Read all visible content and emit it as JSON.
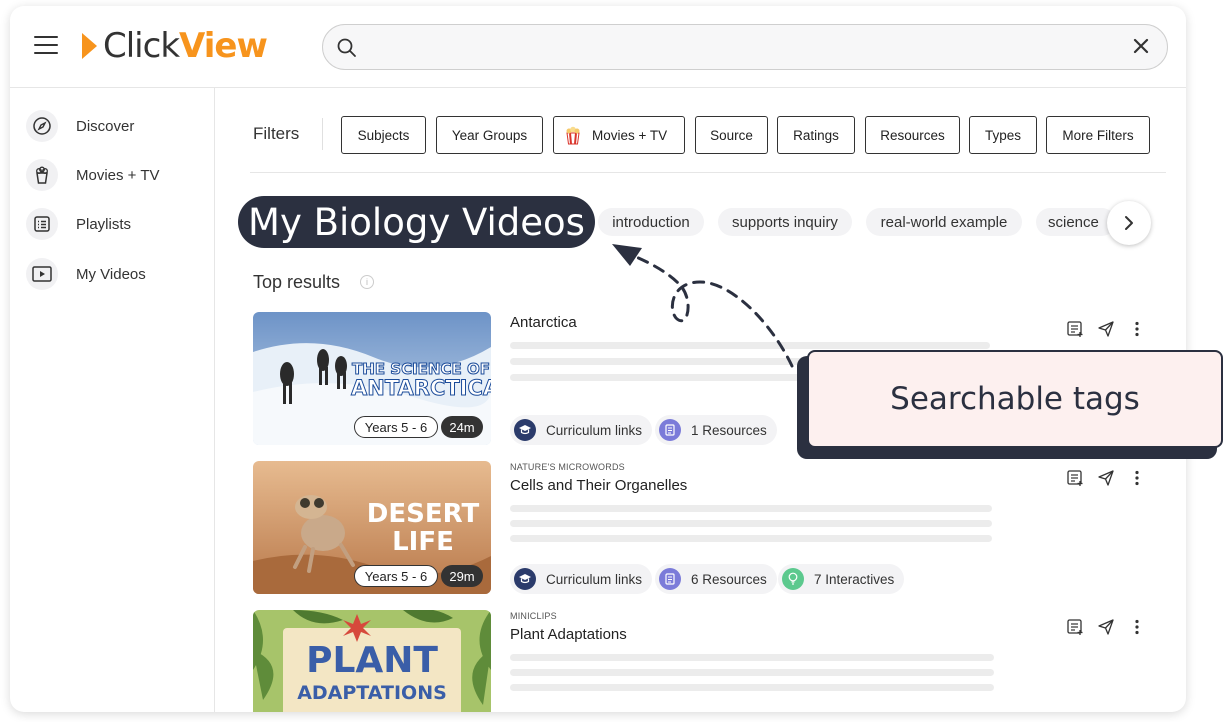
{
  "app": {
    "logo_part1": "Click",
    "logo_part2": "View"
  },
  "search": {
    "value": "",
    "placeholder": ""
  },
  "sidebar": {
    "items": [
      {
        "label": "Discover",
        "icon": "compass-icon"
      },
      {
        "label": "Movies + TV",
        "icon": "popcorn-icon"
      },
      {
        "label": "Playlists",
        "icon": "list-icon"
      },
      {
        "label": "My Videos",
        "icon": "play-icon"
      }
    ]
  },
  "filters": {
    "label": "Filters",
    "buttons": [
      "Subjects",
      "Year Groups",
      "Movies + TV",
      "Source",
      "Ratings",
      "Resources",
      "Types",
      "More Filters"
    ]
  },
  "tags": {
    "highlight": "My Biology Videos",
    "items": [
      "introduction",
      "supports inquiry",
      "real-world example",
      "science"
    ]
  },
  "top_results": {
    "label": "Top results"
  },
  "results": [
    {
      "source": "",
      "title": "Antarctica",
      "thumb_text_1": "THE SCIENCE OF",
      "thumb_text_2": "ANTARCTICA",
      "years": "Years 5 - 6",
      "duration": "24m",
      "badges": [
        "Curriculum links",
        "1 Resources"
      ]
    },
    {
      "source": "NATURE'S MICROWORDS",
      "title": "Cells and Their Organelles",
      "thumb_text_1": "DESERT",
      "thumb_text_2": "LIFE",
      "years": "Years 5 - 6",
      "duration": "29m",
      "badges": [
        "Curriculum links",
        "6 Resources",
        "7 Interactives"
      ]
    },
    {
      "source": "MINICLIPS",
      "title": "Plant Adaptations",
      "thumb_text_1": "PLANT",
      "thumb_text_2": "ADAPTATIONS"
    }
  ],
  "callout": {
    "text": "Searchable tags"
  },
  "colors": {
    "brand": "#f7941d",
    "dark": "#2b3040",
    "callout_bg": "#fdf0ef"
  }
}
